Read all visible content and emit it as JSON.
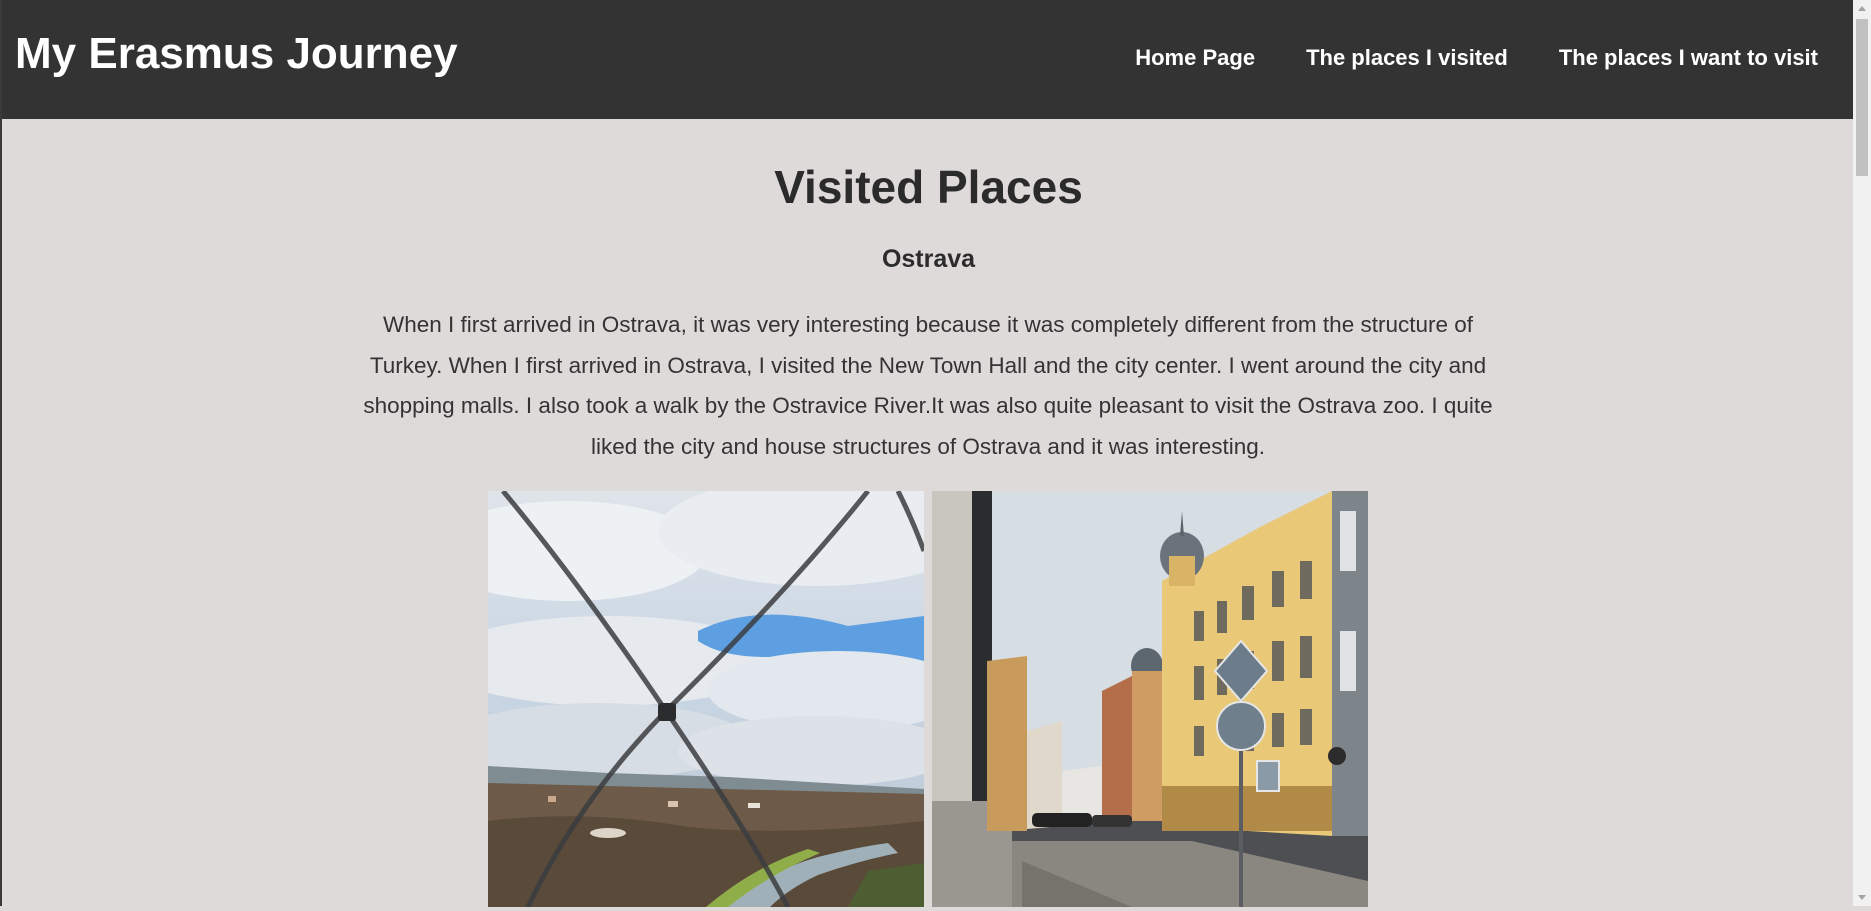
{
  "header": {
    "site_title": "My Erasmus Journey",
    "nav": [
      {
        "label": "Home Page"
      },
      {
        "label": "The places I visited"
      },
      {
        "label": "The places I want to visit"
      }
    ]
  },
  "main": {
    "heading": "Visited Places",
    "section": {
      "title": "Ostrava",
      "description": "When I first arrived in Ostrava, it was very interesting because it was completely different from the structure of Turkey. When I first arrived in Ostrava, I visited the New Town Hall and the city center. I went around the city and shopping malls. I also took a walk by the Ostravice River.It was also quite pleasant to visit the Ostrava zoo. I quite liked the city and house structures of Ostrava and it was interesting.",
      "photos": [
        {
          "subject": "view-through-net-over-river-valley"
        },
        {
          "subject": "street-with-yellow-historic-buildings"
        }
      ]
    }
  },
  "colors": {
    "header_bg": "#333333",
    "page_bg": "#dedada",
    "text": "#2b2b2b",
    "nav_text": "#ffffff"
  }
}
